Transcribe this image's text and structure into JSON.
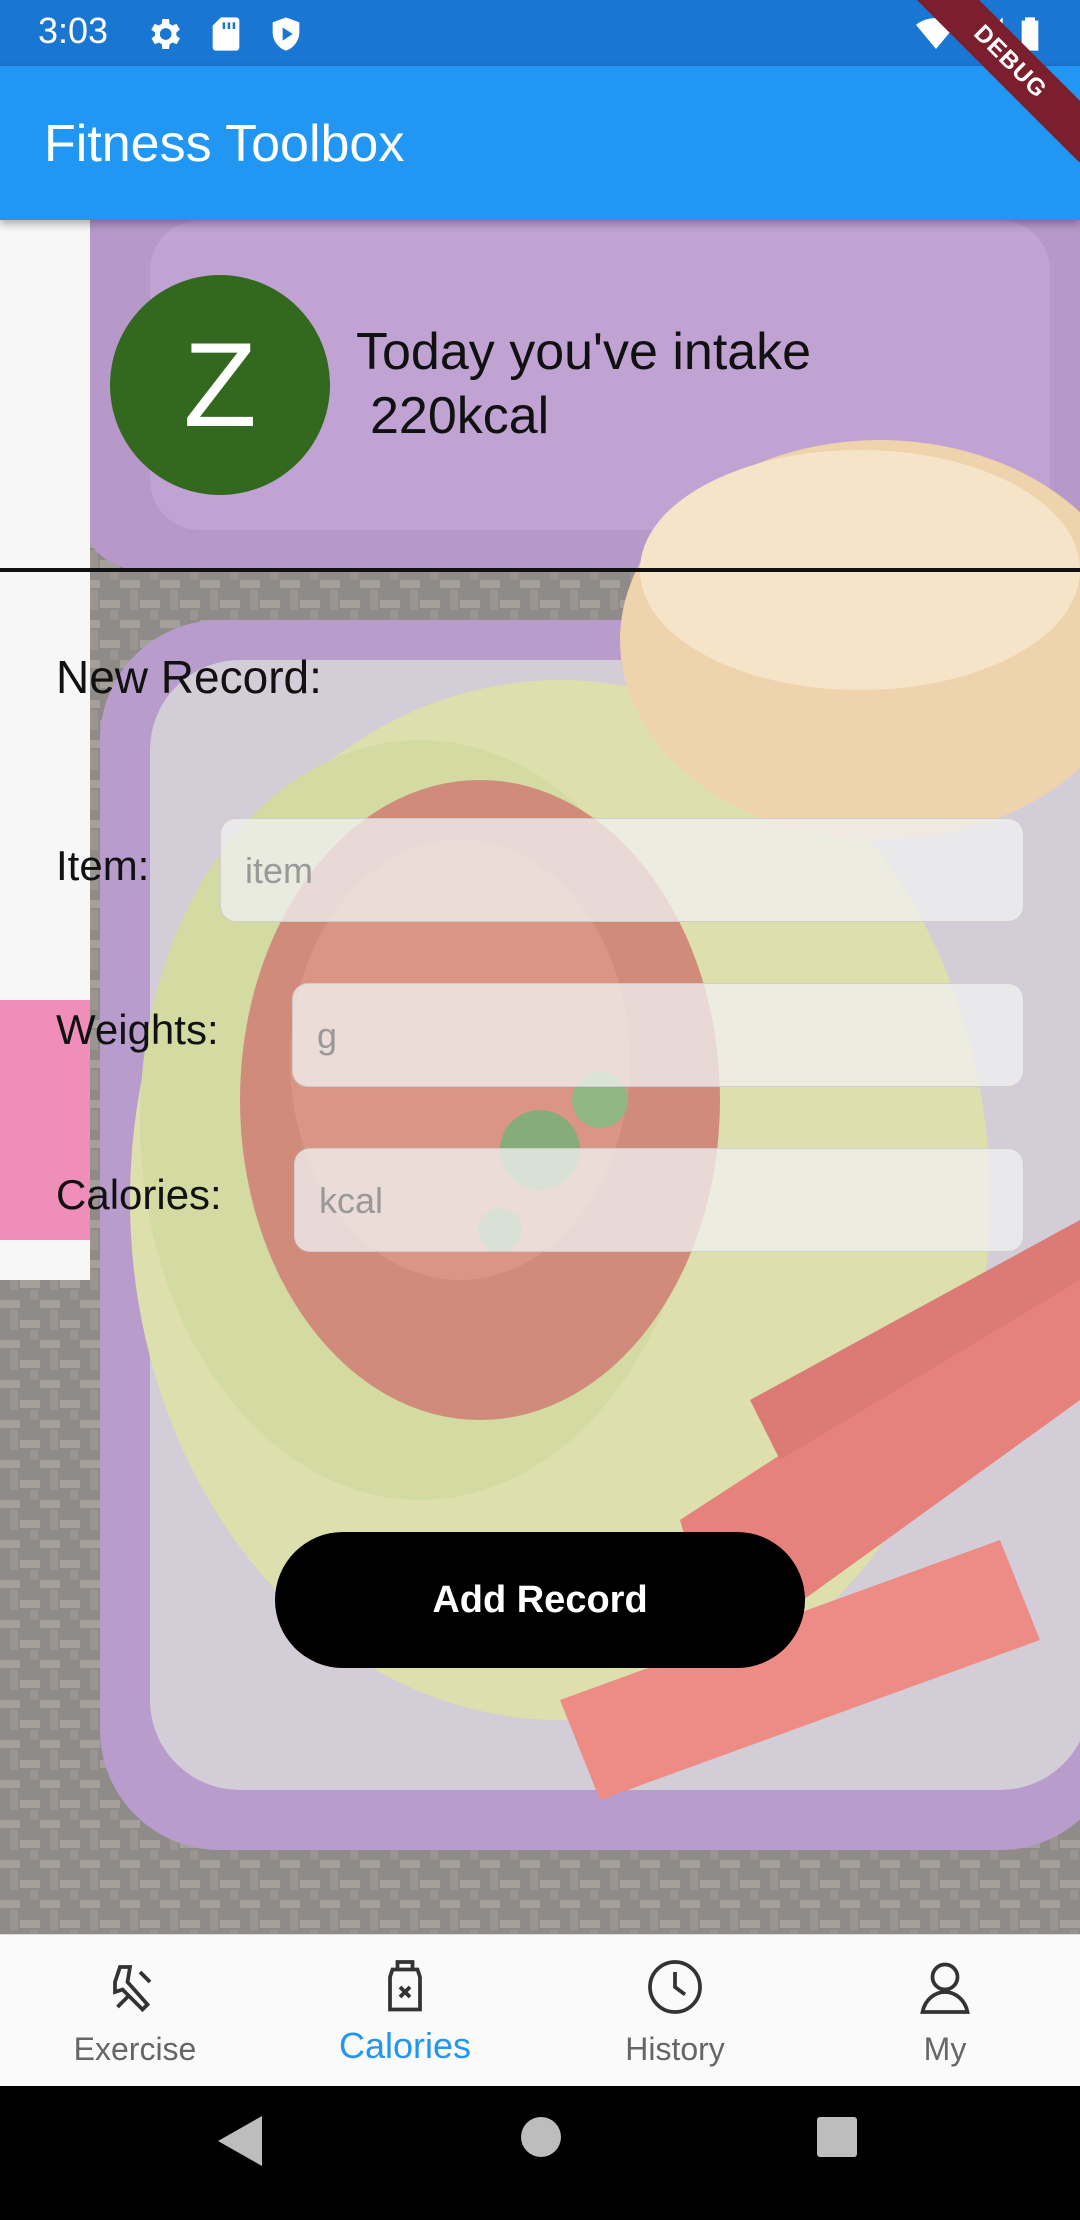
{
  "status_bar": {
    "time": "3:03",
    "icons_left": [
      "settings-icon",
      "sd-card-icon",
      "shield-icon"
    ],
    "icons_right": [
      "wifi-icon",
      "signal-icon",
      "battery-icon"
    ],
    "color": "#1976D2"
  },
  "app_bar": {
    "title": "Fitness Toolbox",
    "color": "#2196F3",
    "debug_label": "DEBUG"
  },
  "summary": {
    "avatar_letter": "Z",
    "avatar_color": "#33691E",
    "line1": "Today you've intake",
    "line2": "220kcal"
  },
  "form": {
    "heading": "New Record:",
    "item_label": "Item:",
    "item_placeholder": "item",
    "weights_label": "Weights:",
    "weights_placeholder": "g",
    "calories_label": "Calories:",
    "calories_placeholder": "kcal",
    "submit_label": "Add Record"
  },
  "bottom_nav": {
    "active_color": "#2196F3",
    "items": [
      {
        "label": "Exercise",
        "icon": "dumbbell-icon"
      },
      {
        "label": "Calories",
        "icon": "food-jar-icon",
        "active": true
      },
      {
        "label": "History",
        "icon": "clock-icon"
      },
      {
        "label": "My",
        "icon": "person-icon"
      }
    ]
  },
  "system_nav": {
    "icons": [
      "back-icon",
      "home-icon",
      "recents-icon"
    ]
  }
}
